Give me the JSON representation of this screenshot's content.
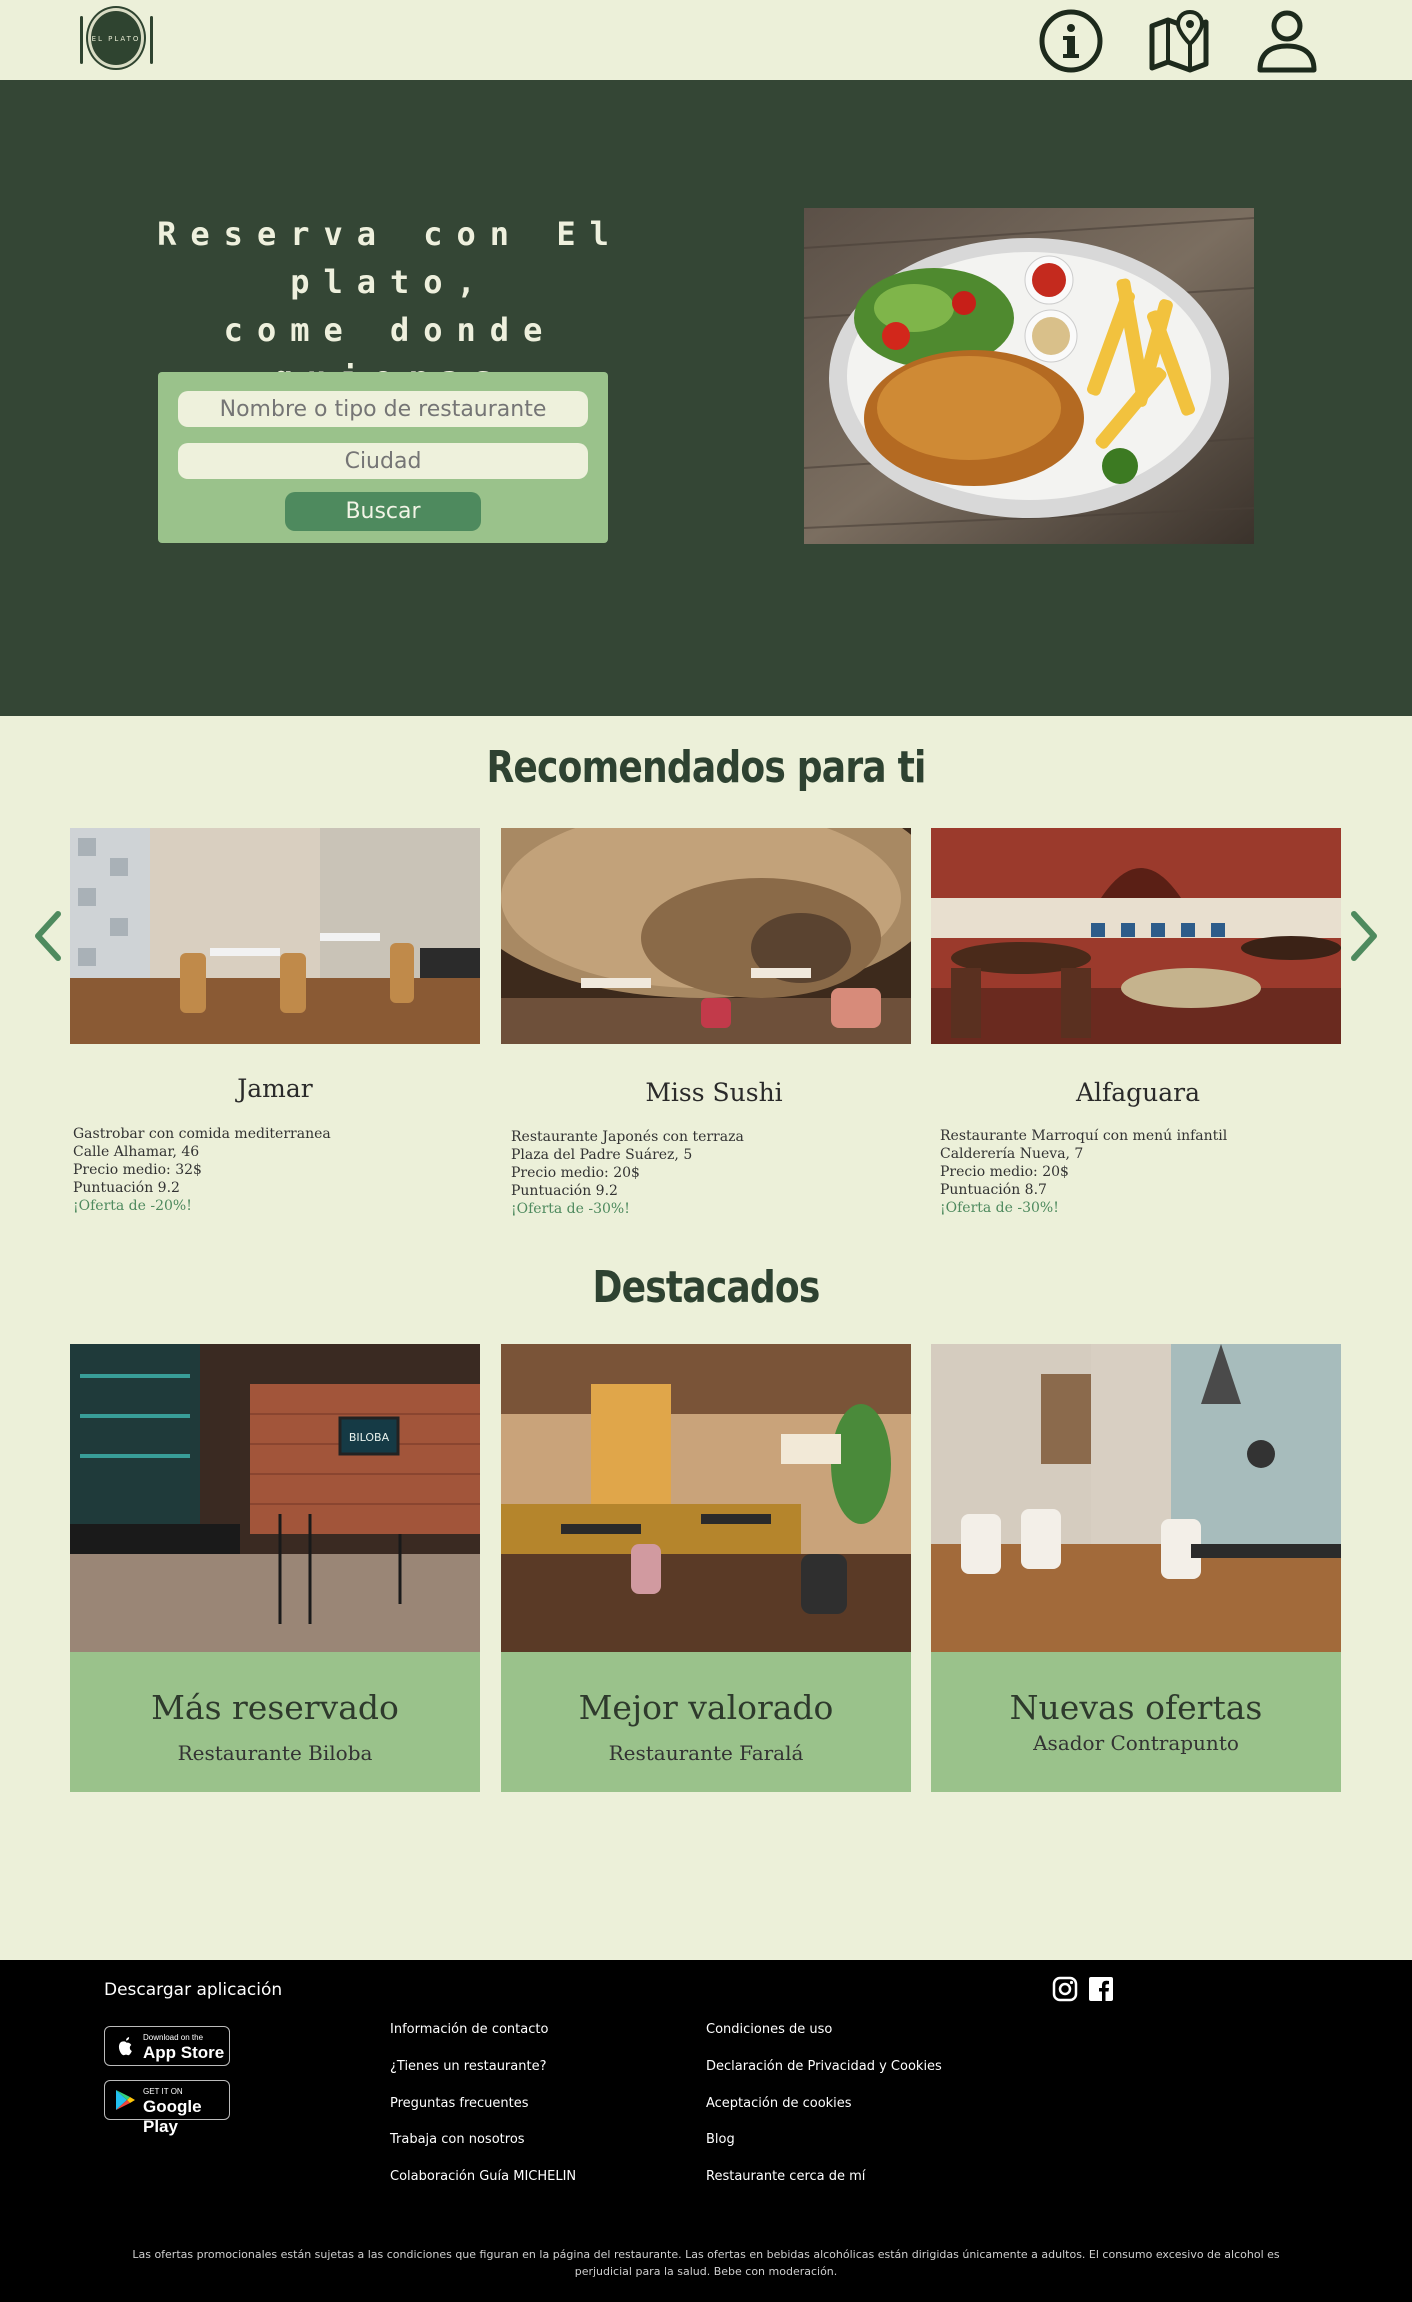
{
  "header": {
    "logo_text": "EL PLATO",
    "icons": [
      "info-icon",
      "map-icon",
      "user-icon"
    ]
  },
  "hero": {
    "title_line1": "Reserva con El plato,",
    "title_line2": "come donde quieras",
    "search_name_placeholder": "Nombre o tipo de restaurante",
    "search_city_placeholder": "Ciudad",
    "search_button": "Buscar"
  },
  "recommended": {
    "title": "Recomendados para ti",
    "cards": [
      {
        "name": "Jamar",
        "description": "Gastrobar con comida mediterranea",
        "address": "Calle Alhamar, 46",
        "price": "Precio medio: 32$",
        "rating": "Puntuación 9.2",
        "offer": "¡Oferta de -20%!"
      },
      {
        "name": "Miss Sushi",
        "description": "Restaurante Japonés con terraza",
        "address": "Plaza del Padre Suárez, 5",
        "price": "Precio medio: 20$",
        "rating": "Puntuación 9.2",
        "offer": "¡Oferta de -30%!"
      },
      {
        "name": "Alfaguara",
        "description": "Restaurante Marroquí con menú infantil",
        "address": "Calderería Nueva, 7",
        "price": "Precio medio: 20$",
        "rating": "Puntuación 8.7",
        "offer": "¡Oferta de -30%!"
      }
    ]
  },
  "featured": {
    "title": "Destacados",
    "cards": [
      {
        "title": "Más reservado",
        "subtitle": "Restaurante Biloba",
        "sign": "BILOBA"
      },
      {
        "title": "Mejor valorado",
        "subtitle": "Restaurante Faralá"
      },
      {
        "title": "Nuevas ofertas",
        "subtitle": "Asador Contrapunto"
      }
    ]
  },
  "footer": {
    "download_title": "Descargar aplicación",
    "app_store_small": "Download on the",
    "app_store_large": "App Store",
    "google_small": "GET IT ON",
    "google_large": "Google Play",
    "links_col1": [
      "Información de contacto",
      "¿Tienes un restaurante?",
      "Preguntas frecuentes",
      "Trabaja con nosotros",
      "Colaboración Guía MICHELIN"
    ],
    "links_col2": [
      "Condiciones de uso",
      "Declaración de Privacidad y Cookies",
      "Aceptación de cookies",
      "Blog",
      "Restaurante cerca de mí"
    ],
    "legal_line1": "Las ofertas promocionales están sujetas a las condiciones que figuran en la página del restaurante. Las ofertas en bebidas alcohólicas están dirigidas únicamente a adultos. El consumo excesivo de alcohol es",
    "legal_line2": "perjudicial para la salud. Bebe con moderación."
  },
  "colors": {
    "background": "#ecf0d9",
    "hero": "#344635",
    "accent_green": "#9ac28b",
    "button_green": "#4e8a5e",
    "footer": "#000000"
  }
}
